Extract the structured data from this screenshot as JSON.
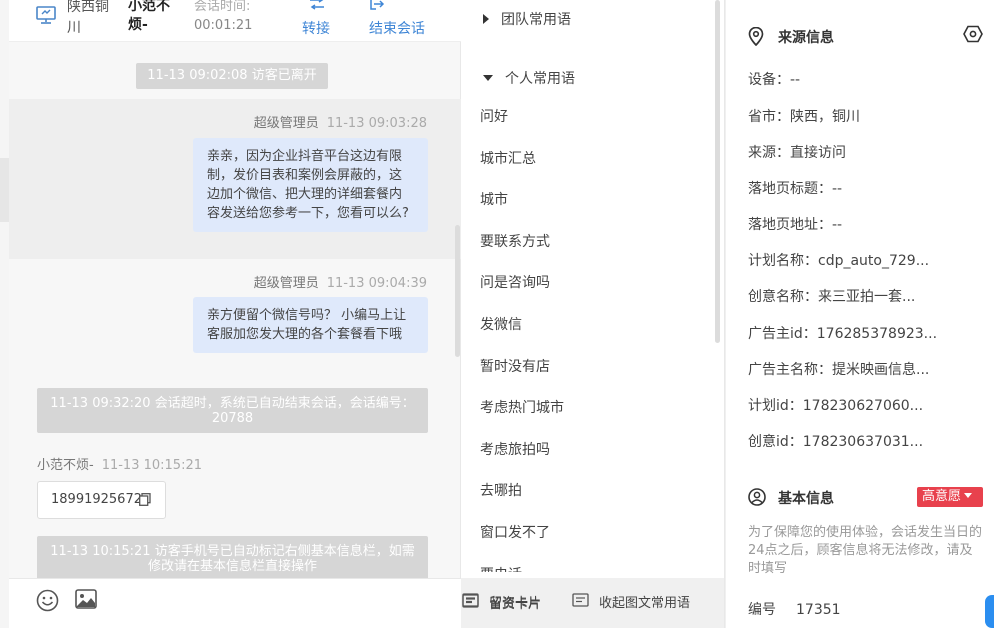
{
  "header": {
    "region": "陕西铜川",
    "visitor_name": "小范不烦-",
    "session_time_label": "会话时间:",
    "session_time": "00:01:21",
    "transfer_label": "转接",
    "end_label": "结束会话"
  },
  "messages": {
    "sys1": "11-13 09:02:08 访客已离开",
    "m1_sender": "超级管理员",
    "m1_time": "11-13 09:03:28",
    "m1_text": "亲亲，因为企业抖音平台这边有限制，发价目表和案例会屏蔽的，这边加个微信、把大理的详细套餐内容发送给您参考一下，您看可以么?",
    "m2_sender": "超级管理员",
    "m2_time": "11-13 09:04:39",
    "m2_text": "亲方便留个微信号吗？ 小编马上让客服加您发大理的各个套餐看下哦",
    "sys2": "11-13 09:32:20 会话超时，系统已自动结束会话，会话编号：20788",
    "m3_sender": "小范不烦-",
    "m3_time": "11-13 10:15:21",
    "m3_phone": "18991925672",
    "sys3": "11-13 10:15:21 访客手机号已自动标记右侧基本信息栏，如需修改请在基本信息栏直接操作"
  },
  "footer": {
    "lead_card": "留资卡片",
    "collapse": "收起图文常用语"
  },
  "phrases": {
    "team_group": "团队常用语",
    "personal_group": "个人常用语",
    "items": [
      "问好",
      "城市汇总",
      "城市",
      "要联系方式",
      "问是咨询吗",
      "发微信",
      "暂时没有店",
      "考虑热门城市",
      "考虑旅拍吗",
      "去哪拍",
      "窗口发不了",
      "要电话"
    ]
  },
  "source_info": {
    "title": "来源信息",
    "rows": [
      "设备：--",
      "省市：陕西，铜川",
      "来源：直接访问",
      "落地页标题：--",
      "落地页地址：--",
      "计划名称：cdp_auto_729...",
      "创意名称：来三亚拍一套...",
      "广告主id：176285378923...",
      "广告主名称：提米映画信息...",
      "计划id：178230627060...",
      "创意id：178230637031..."
    ]
  },
  "basic_info": {
    "title": "基本信息",
    "intent_badge": "高意愿",
    "note": "为了保障您的使用体验，会话发生当日的24点之后，顾客信息将无法修改，请及时填写",
    "id_label": "编号",
    "id_value": "17351"
  },
  "colors": {
    "accent": "#3f86d6",
    "bubble": "#dfe9fb",
    "badge": "#e8414d"
  }
}
